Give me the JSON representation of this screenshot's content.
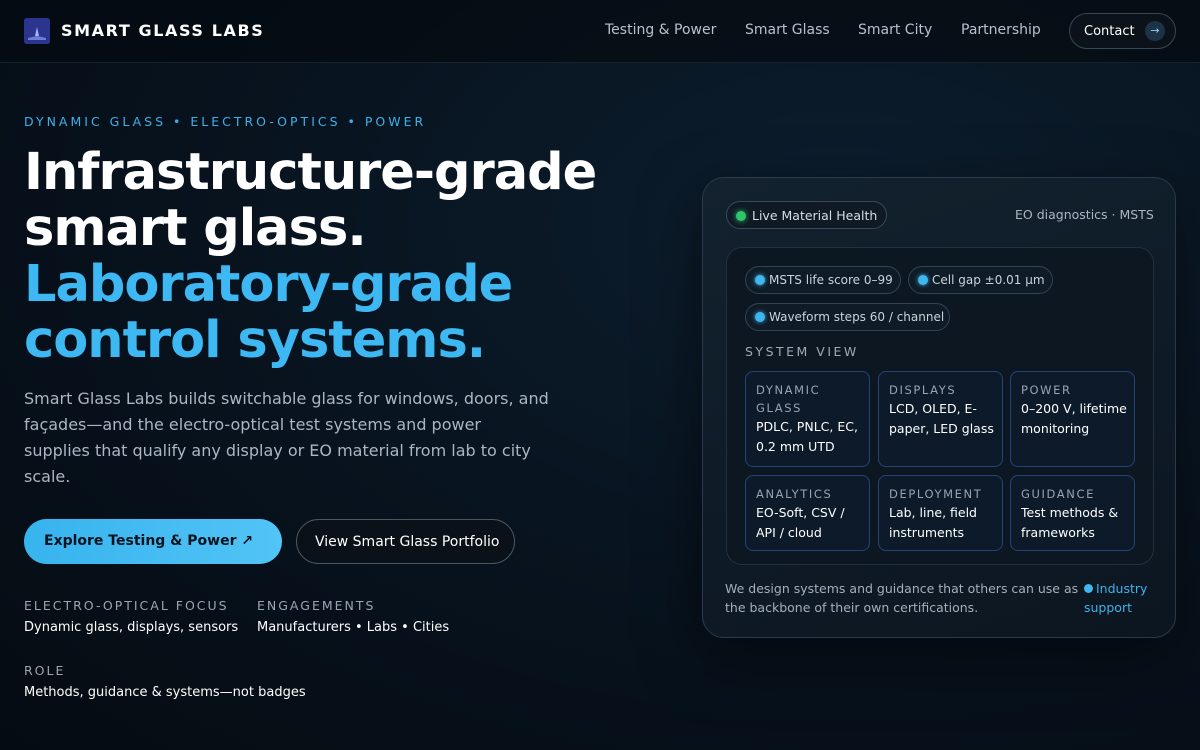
{
  "nav": {
    "brand": "SMART GLASS LABS",
    "links": [
      "Testing & Power",
      "Smart Glass",
      "Smart City",
      "Partnership"
    ],
    "contact": "Contact",
    "contact_arrow": "→"
  },
  "hero": {
    "eyebrow": "DYNAMIC GLASS • ELECTRO-OPTICS • POWER",
    "headline_white_1": "Infrastructure-grade",
    "headline_white_2": "smart glass.",
    "headline_blue_1": "Laboratory-grade",
    "headline_blue_2": "control systems.",
    "lead": "Smart Glass Labs builds switchable glass for windows, doors, and façades—and the electro-optical test systems and power supplies that qualify any display or EO material from lab to city scale.",
    "primary_button": "Explore Testing & Power ↗",
    "secondary_button": "View Smart Glass Portfolio",
    "meta": [
      {
        "label": "ELECTRO-OPTICAL FOCUS",
        "value": "Dynamic glass, displays, sensors"
      },
      {
        "label": "ENGAGEMENTS",
        "value": "Manufacturers • Labs • Cities"
      },
      {
        "label": "ROLE",
        "value": "Methods, guidance & systems—not badges"
      }
    ]
  },
  "panel": {
    "status_pill": "Live Material Health",
    "diagnostics": "EO diagnostics · MSTS",
    "chips": [
      "MSTS life score 0–99",
      "Cell gap ±0.01 µm",
      "Waveform steps 60 / channel"
    ],
    "system_view_title": "SYSTEM VIEW",
    "cards": [
      {
        "title": "DYNAMIC GLASS",
        "body": "PDLC, PNLC, EC, 0.2 mm UTD"
      },
      {
        "title": "DISPLAYS",
        "body": "LCD, OLED, E-paper, LED glass"
      },
      {
        "title": "POWER",
        "body": "0–200 V, lifetime monitoring"
      },
      {
        "title": "ANALYTICS",
        "body": "EO-Soft, CSV / API / cloud"
      },
      {
        "title": "DEPLOYMENT",
        "body": "Lab, line, field instruments"
      },
      {
        "title": "GUIDANCE",
        "body": "Test methods & frameworks"
      }
    ],
    "footer_text": "We design systems and guidance that others can use as the backbone of their own certifications.",
    "support_label": "Industry support"
  },
  "colors": {
    "accent": "#3db8f2",
    "background": "#07111b",
    "status_green": "#2ec46a"
  }
}
